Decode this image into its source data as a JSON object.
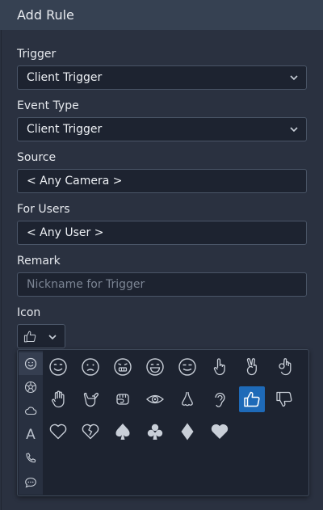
{
  "header": {
    "title": "Add Rule"
  },
  "form": {
    "trigger": {
      "label": "Trigger",
      "value": "Client Trigger"
    },
    "event_type": {
      "label": "Event Type",
      "value": "Client Trigger"
    },
    "source": {
      "label": "Source",
      "value": "< Any Camera >"
    },
    "for_users": {
      "label": "For Users",
      "value": "< Any User >"
    },
    "remark": {
      "label": "Remark",
      "value": "",
      "placeholder": "Nickname for Trigger"
    },
    "icon": {
      "label": "Icon",
      "selected": "thumbs-up"
    }
  },
  "picker": {
    "categories": [
      "smiley",
      "sports",
      "weather",
      "letters",
      "communication",
      "chat"
    ],
    "active_category": "smiley",
    "glyph_letter": "A",
    "rows": [
      [
        "smile",
        "frown",
        "grimace",
        "grin",
        "smirk",
        "pointing-up",
        "victory",
        "ok-hand"
      ],
      [
        "raised-hand",
        "call-me",
        "fist",
        "eye",
        "nose",
        "ear",
        "thumbs-up",
        "thumbs-down"
      ],
      [
        "heart",
        "broken-heart",
        "spade",
        "club",
        "diamond",
        "heart-solid"
      ]
    ],
    "selected_index": 14,
    "colors": {
      "accent": "#1e6ab8",
      "icon": "#c9cfd8"
    }
  }
}
